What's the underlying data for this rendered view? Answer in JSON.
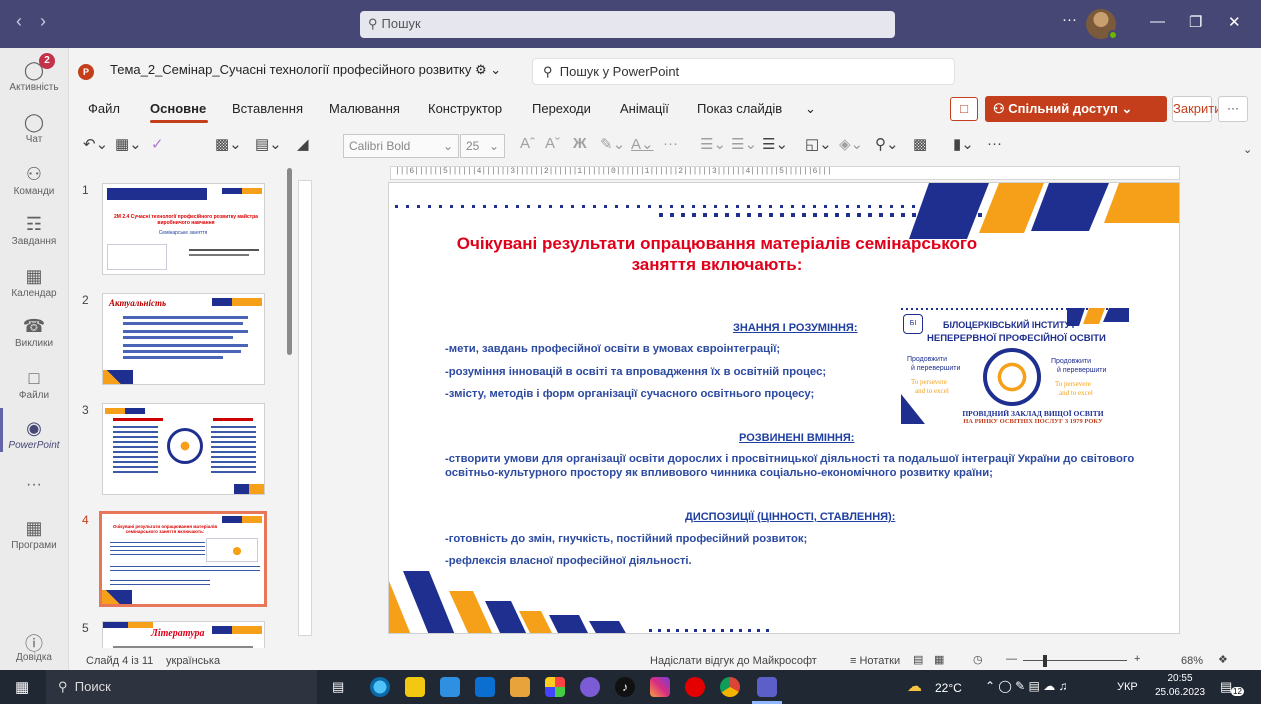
{
  "teams": {
    "search_placeholder": "Пошук",
    "activity_badge": "2",
    "rail": [
      {
        "label": "Активність",
        "icon": "bell-icon"
      },
      {
        "label": "Чат",
        "icon": "chat-icon"
      },
      {
        "label": "Команди",
        "icon": "teams-icon"
      },
      {
        "label": "Завдання",
        "icon": "assignments-icon"
      },
      {
        "label": "Календар",
        "icon": "calendar-icon"
      },
      {
        "label": "Виклики",
        "icon": "phone-icon"
      },
      {
        "label": "Файли",
        "icon": "file-icon"
      },
      {
        "label": "PowerPoint",
        "icon": "powerpoint-icon"
      },
      {
        "label": "Програми",
        "icon": "apps-icon"
      },
      {
        "label": "Довідка",
        "icon": "help-icon"
      }
    ]
  },
  "ppt": {
    "doc_title": "Тема_2_Семінар_Сучасні технології професійного розвитку",
    "search_label": "Пошук у PowerPoint",
    "tabs": [
      "Файл",
      "Основне",
      "Вставлення",
      "Малювання",
      "Конструктор",
      "Переходи",
      "Анімації",
      "Показ слайдів"
    ],
    "active_tab": "Основне",
    "share_label": "Спільний доступ",
    "close_label": "Закрити",
    "font_name": "Calibri Bold",
    "font_size": "25"
  },
  "thumbnails": [
    {
      "num": "1",
      "title": "2М 2.4 Сучасні технології професійного розвитку майстра виробничого навчання",
      "sub": "Семінарське заняття"
    },
    {
      "num": "2",
      "title": "Актуальність"
    },
    {
      "num": "3",
      "title": ""
    },
    {
      "num": "4",
      "title": "Очікувані результати опрацювання матеріалів семінарського заняття включають:"
    },
    {
      "num": "5",
      "title": "Література"
    }
  ],
  "slide": {
    "title": "Очікувані результати опрацювання матеріалів семінарського заняття включають:",
    "section1_head": "ЗНАННЯ І РОЗУМІННЯ:",
    "section1_items": [
      "-мети, завдань  професійної освіти  в умовах євроінтеграції;",
      "-розуміння інновацій в освіті та впровадження їх в освітній процес;",
      "-змісту, методів і форм організації сучасного освітнього процесу;"
    ],
    "section2_head": "РОЗВИНЕНІ ВМІННЯ:",
    "section2_text": "-створити умови для організації освіти дорослих і просвітницької діяльності та подальшої інтеграції України до світового освітньо-культурного простору як впливового чинника соціально-економічного розвитку країни;",
    "section3_head": "ДИСПОЗИЦІЇ (ЦІННОСТІ, СТАВЛЕННЯ):",
    "section3_items": [
      "-готовність до змін, гнучкість, постійний професійний розвиток;",
      "-рефлексія власної професійної діяльності."
    ],
    "logo": {
      "name_line1": "БІЛОЦЕРКІВСЬКИЙ  ІНСТИТУТ",
      "name_line2": "НЕПЕРЕРВНОЇ ПРОФЕСІЙНОЇ ОСВІТИ",
      "left_ua1": "Продовжити",
      "left_ua2": "й перевершити",
      "left_en1": "To persevere",
      "left_en2": "and to excel",
      "right_ua1": "Продовжити",
      "right_ua2": "й перевершити",
      "right_en1": "To persevere",
      "right_en2": "and to excel",
      "bottom1": "ПРОВІДНИЙ ЗАКЛАД ВИЩОЇ ОСВІТИ",
      "bottom2": "НА РИНКУ ОСВІТНІХ ПОСЛУГ З 1979 РОКУ"
    }
  },
  "status": {
    "slide_info": "Слайд 4 із 11",
    "language": "українська",
    "feedback": "Надіслати відгук до Майкрософт",
    "notes": "Нотатки",
    "zoom": "68%"
  },
  "taskbar": {
    "search": "Поиск",
    "temperature": "22°C",
    "lang": "УКР",
    "time": "20:55",
    "date": "25.06.2023",
    "notif_count": "12"
  },
  "colors": {
    "teams_purple": "#464775",
    "ppt_red": "#c43e1c",
    "slide_title_red": "#e0001a",
    "slide_text_blue": "#2c4aa0",
    "stripe_navy": "#1f2f8f",
    "stripe_orange": "#f5a018"
  }
}
